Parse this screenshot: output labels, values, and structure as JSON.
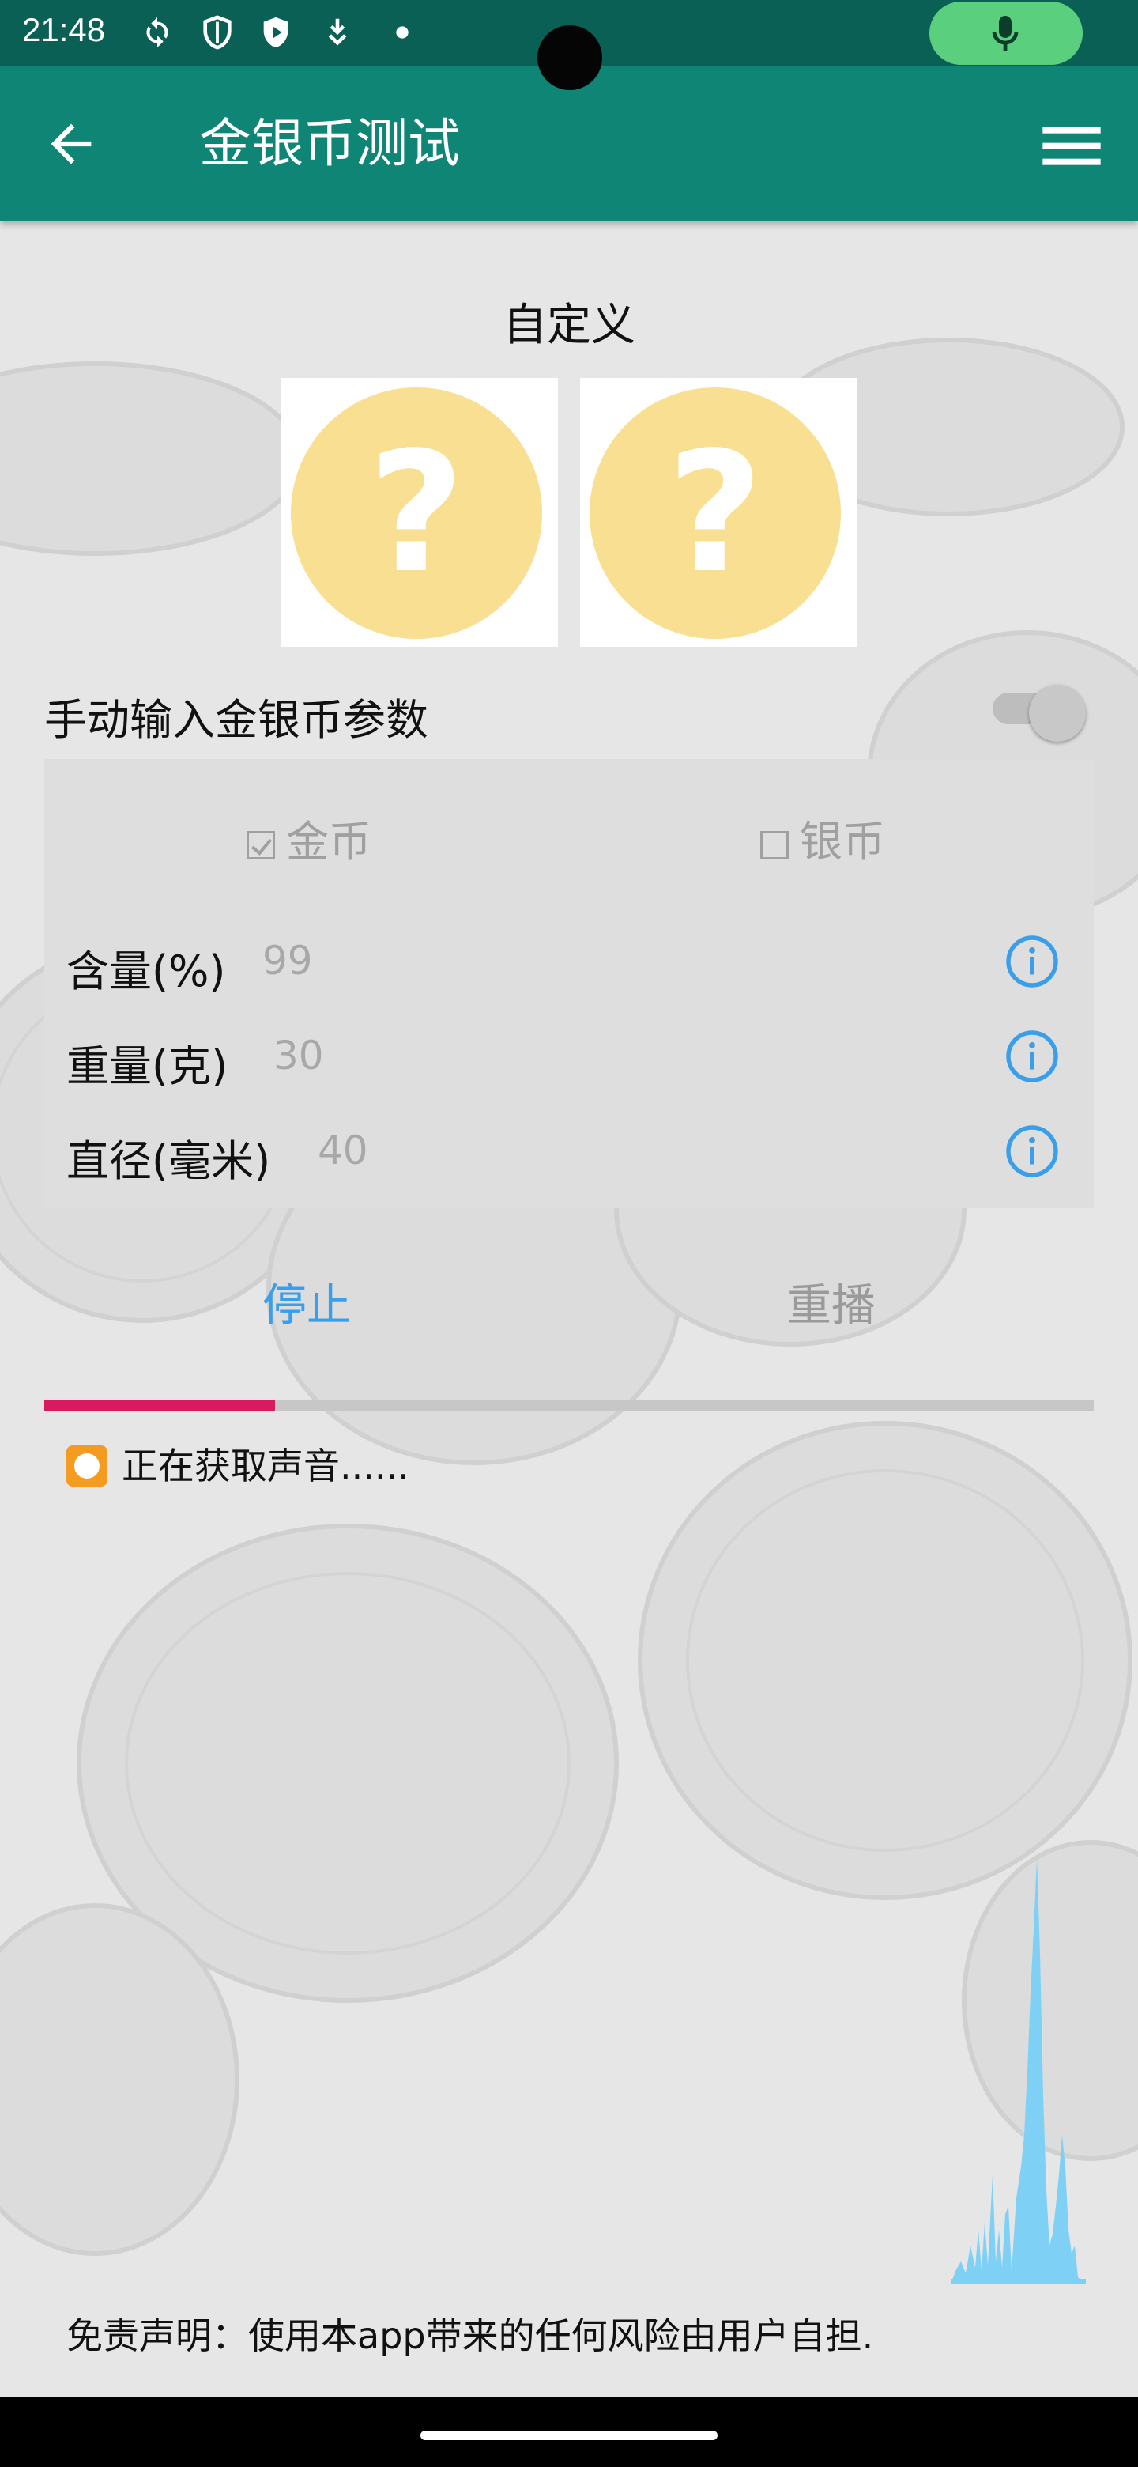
{
  "status_bar": {
    "time": "21:48",
    "icons": [
      "sync-icon",
      "shield-icon",
      "play-shield-icon",
      "download-icon",
      "dot-icon",
      "mic-icon"
    ]
  },
  "app_bar": {
    "title": "金银币测试",
    "back_icon": "arrow-back-icon",
    "menu_icon": "menu-icon"
  },
  "header": {
    "custom_label": "自定义",
    "coin_placeholder": "?"
  },
  "manual_input": {
    "label": "手动输入金银币参数",
    "toggle_on": false
  },
  "params": {
    "gold": {
      "label": "金币",
      "checked": true
    },
    "silver": {
      "label": "银币",
      "checked": false
    },
    "rows": [
      {
        "label": "含量(%)",
        "value": "99"
      },
      {
        "label": "重量(克)",
        "value": "30"
      },
      {
        "label": "直径(毫米)",
        "value": "40"
      }
    ]
  },
  "controls": {
    "stop_label": "停止",
    "replay_label": "重播",
    "progress_fraction": 0.22
  },
  "status": {
    "text": "正在获取声音......"
  },
  "disclaimer": "免责声明：使用本app带来的任何风险由用户自担.",
  "colors": {
    "status_bar": "#0b6055",
    "app_bar": "#0f8576",
    "accent_blue": "#3a9ee8",
    "progress": "#d81b60",
    "waveform": "#7fd0f5",
    "coin_placeholder": "#f9df92"
  }
}
